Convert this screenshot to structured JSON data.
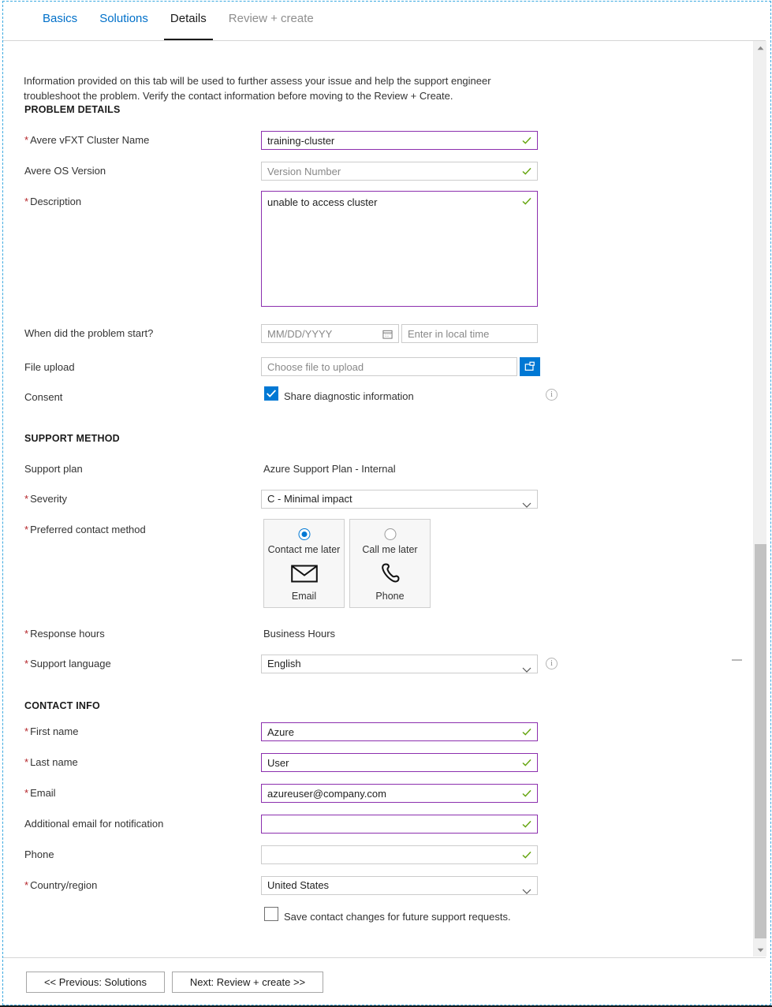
{
  "tabs": [
    {
      "label": "Basics",
      "state": "link"
    },
    {
      "label": "Solutions",
      "state": "link"
    },
    {
      "label": "Details",
      "state": "active"
    },
    {
      "label": "Review + create",
      "state": "disabled"
    }
  ],
  "intro": "Information provided on this tab will be used to further assess your issue and help the support engineer troubleshoot the problem. Verify the contact information before moving to the Review + Create.",
  "sections": {
    "problem_details": "PROBLEM DETAILS",
    "support_method": "SUPPORT METHOD",
    "contact_info": "CONTACT INFO"
  },
  "problem": {
    "cluster_name_label": "Avere vFXT Cluster Name",
    "cluster_name_value": "training-cluster",
    "os_version_label": "Avere OS Version",
    "os_version_placeholder": "Version Number",
    "description_label": "Description",
    "description_value": "unable to access cluster",
    "start_label": "When did the problem start?",
    "start_date_placeholder": "MM/DD/YYYY",
    "start_time_placeholder": "Enter in local time",
    "file_upload_label": "File upload",
    "file_upload_placeholder": "Choose file to upload",
    "consent_label": "Consent",
    "consent_checkbox_label": "Share diagnostic information",
    "consent_checked": true
  },
  "support": {
    "plan_label": "Support plan",
    "plan_value": "Azure Support Plan - Internal",
    "severity_label": "Severity",
    "severity_value": "C - Minimal impact",
    "contact_method_label": "Preferred contact method",
    "methods": [
      {
        "top": "Contact me later",
        "bottom": "Email",
        "icon": "envelope-icon",
        "selected": true
      },
      {
        "top": "Call me later",
        "bottom": "Phone",
        "icon": "phone-icon",
        "selected": false
      }
    ],
    "response_hours_label": "Response hours",
    "response_hours_value": "Business Hours",
    "language_label": "Support language",
    "language_value": "English"
  },
  "contact": {
    "first_name_label": "First name",
    "first_name_value": "Azure",
    "last_name_label": "Last name",
    "last_name_value": "User",
    "email_label": "Email",
    "email_value": "azureuser@company.com",
    "additional_email_label": "Additional email for notification",
    "additional_email_value": "",
    "phone_label": "Phone",
    "phone_value": "",
    "country_label": "Country/region",
    "country_value": "United States",
    "save_contact_label": "Save contact changes for future support requests.",
    "save_contact_checked": false
  },
  "footer": {
    "previous_label": "<< Previous: Solutions",
    "next_label": "Next: Review + create >>"
  },
  "colors": {
    "accent_blue": "#0078d4",
    "link_blue": "#0070c9",
    "valid_purple": "#8c2fae",
    "check_green": "#67a612",
    "required_red": "#b4252a"
  }
}
